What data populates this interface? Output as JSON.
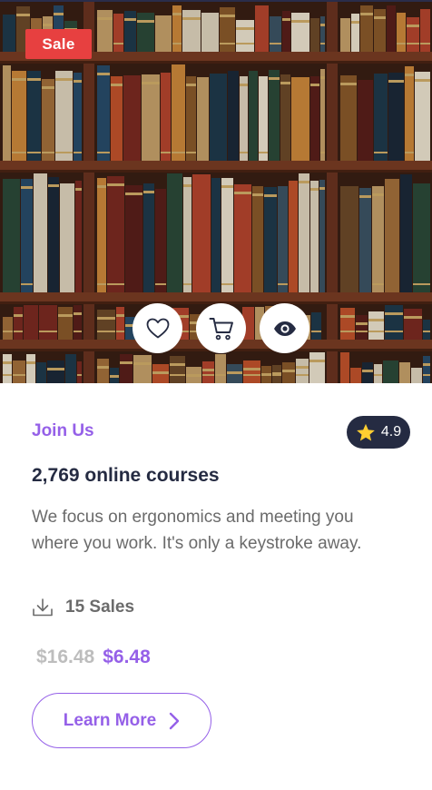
{
  "badge": {
    "label": "Sale"
  },
  "actions": [
    {
      "icon": "heart-icon"
    },
    {
      "icon": "cart-icon"
    },
    {
      "icon": "eye-icon"
    }
  ],
  "card": {
    "category": "Join Us",
    "rating": "4.9",
    "title": "2,769 online courses",
    "description": "We focus on ergonomics and meeting you where you work. It's only a keystroke away.",
    "sales": "15 Sales",
    "old_price": "$16.48",
    "new_price": "$6.48",
    "cta_label": "Learn More"
  },
  "colors": {
    "accent": "#9560E8",
    "sale": "#E74040",
    "dark": "#252B42",
    "star": "#FFCE31",
    "muted": "#BDBDBD"
  }
}
